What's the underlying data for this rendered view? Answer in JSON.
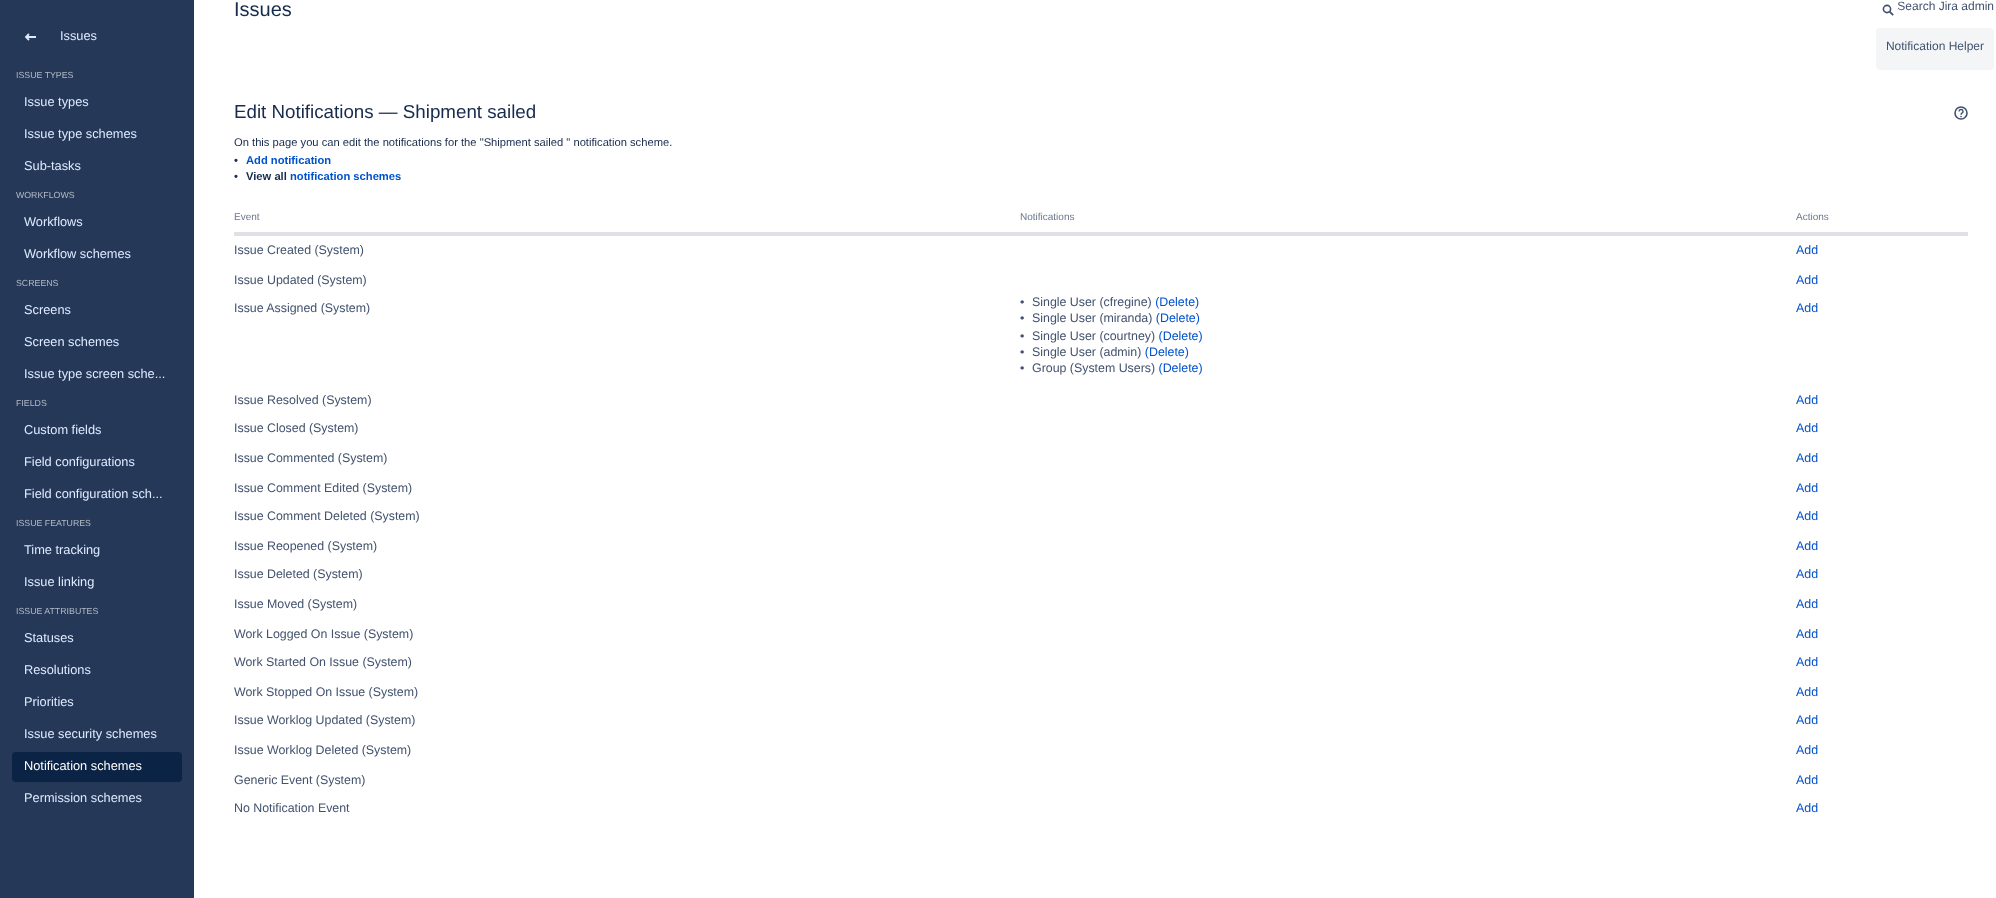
{
  "sidebar": {
    "back": {
      "label": "Issues"
    },
    "sections": [
      {
        "heading": "ISSUE TYPES",
        "items": [
          {
            "label": "Issue types",
            "selected": false
          },
          {
            "label": "Issue type schemes",
            "selected": false
          },
          {
            "label": "Sub-tasks",
            "selected": false
          }
        ]
      },
      {
        "heading": "WORKFLOWS",
        "items": [
          {
            "label": "Workflows",
            "selected": false
          },
          {
            "label": "Workflow schemes",
            "selected": false
          }
        ]
      },
      {
        "heading": "SCREENS",
        "items": [
          {
            "label": "Screens",
            "selected": false
          },
          {
            "label": "Screen schemes",
            "selected": false
          },
          {
            "label": "Issue type screen sche...",
            "selected": false
          }
        ]
      },
      {
        "heading": "FIELDS",
        "items": [
          {
            "label": "Custom fields",
            "selected": false
          },
          {
            "label": "Field configurations",
            "selected": false
          },
          {
            "label": "Field configuration sch...",
            "selected": false
          }
        ]
      },
      {
        "heading": "ISSUE FEATURES",
        "items": [
          {
            "label": "Time tracking",
            "selected": false
          },
          {
            "label": "Issue linking",
            "selected": false
          }
        ]
      },
      {
        "heading": "ISSUE ATTRIBUTES",
        "items": [
          {
            "label": "Statuses",
            "selected": false
          },
          {
            "label": "Resolutions",
            "selected": false
          },
          {
            "label": "Priorities",
            "selected": false
          },
          {
            "label": "Issue security schemes",
            "selected": false
          },
          {
            "label": "Notification schemes",
            "selected": true
          },
          {
            "label": "Permission schemes",
            "selected": false
          }
        ]
      }
    ]
  },
  "header": {
    "page_title": "Issues",
    "search": "Search Jira admin",
    "helper_button": "Notification Helper"
  },
  "content": {
    "title": "Edit Notifications — Shipment sailed",
    "intro": "On this page you can edit the notifications for the \"Shipment sailed \" notification scheme.",
    "links": [
      {
        "bullet": "•",
        "link": "Add notification"
      },
      {
        "bullet": "•",
        "prefix": "View all",
        "link": "notification schemes"
      }
    ],
    "table": {
      "columns": [
        "Event",
        "Notifications",
        "Actions"
      ],
      "rows": [
        {
          "event": "Issue Created (System)",
          "notifications": [],
          "action": "Add"
        },
        {
          "event": "Issue Updated (System)",
          "notifications": [],
          "action": "Add"
        },
        {
          "event": "Issue Assigned (System)",
          "notifications": [
            {
              "bullet": "•",
              "label": "Single User (cfregine)",
              "action": "(Delete)"
            },
            {
              "bullet": "•",
              "label": "Single User (miranda)",
              "action": "(Delete)"
            },
            {
              "bullet": "•",
              "label": "Single User (courtney)",
              "action": "(Delete)"
            },
            {
              "bullet": "•",
              "label": "Single User (admin)",
              "action": "(Delete)"
            },
            {
              "bullet": "•",
              "label": "Group (System Users)",
              "action": "(Delete)"
            }
          ],
          "action": "Add"
        },
        {
          "event": "Issue Resolved (System)",
          "notifications": [],
          "action": "Add"
        },
        {
          "event": "Issue Closed (System)",
          "notifications": [],
          "action": "Add"
        },
        {
          "event": "Issue Commented (System)",
          "notifications": [],
          "action": "Add"
        },
        {
          "event": "Issue Comment Edited (System)",
          "notifications": [],
          "action": "Add"
        },
        {
          "event": "Issue Comment Deleted (System)",
          "notifications": [],
          "action": "Add"
        },
        {
          "event": "Issue Reopened (System)",
          "notifications": [],
          "action": "Add"
        },
        {
          "event": "Issue Deleted (System)",
          "notifications": [],
          "action": "Add"
        },
        {
          "event": "Issue Moved (System)",
          "notifications": [],
          "action": "Add"
        },
        {
          "event": "Work Logged On Issue (System)",
          "notifications": [],
          "action": "Add"
        },
        {
          "event": "Work Started On Issue (System)",
          "notifications": [],
          "action": "Add"
        },
        {
          "event": "Work Stopped On Issue (System)",
          "notifications": [],
          "action": "Add"
        },
        {
          "event": "Issue Worklog Updated (System)",
          "notifications": [],
          "action": "Add"
        },
        {
          "event": "Issue Worklog Deleted (System)",
          "notifications": [],
          "action": "Add"
        },
        {
          "event": "Generic Event (System)",
          "notifications": [],
          "action": "Add"
        },
        {
          "event": "No Notification Event",
          "notifications": [],
          "action": "Add"
        }
      ]
    }
  }
}
